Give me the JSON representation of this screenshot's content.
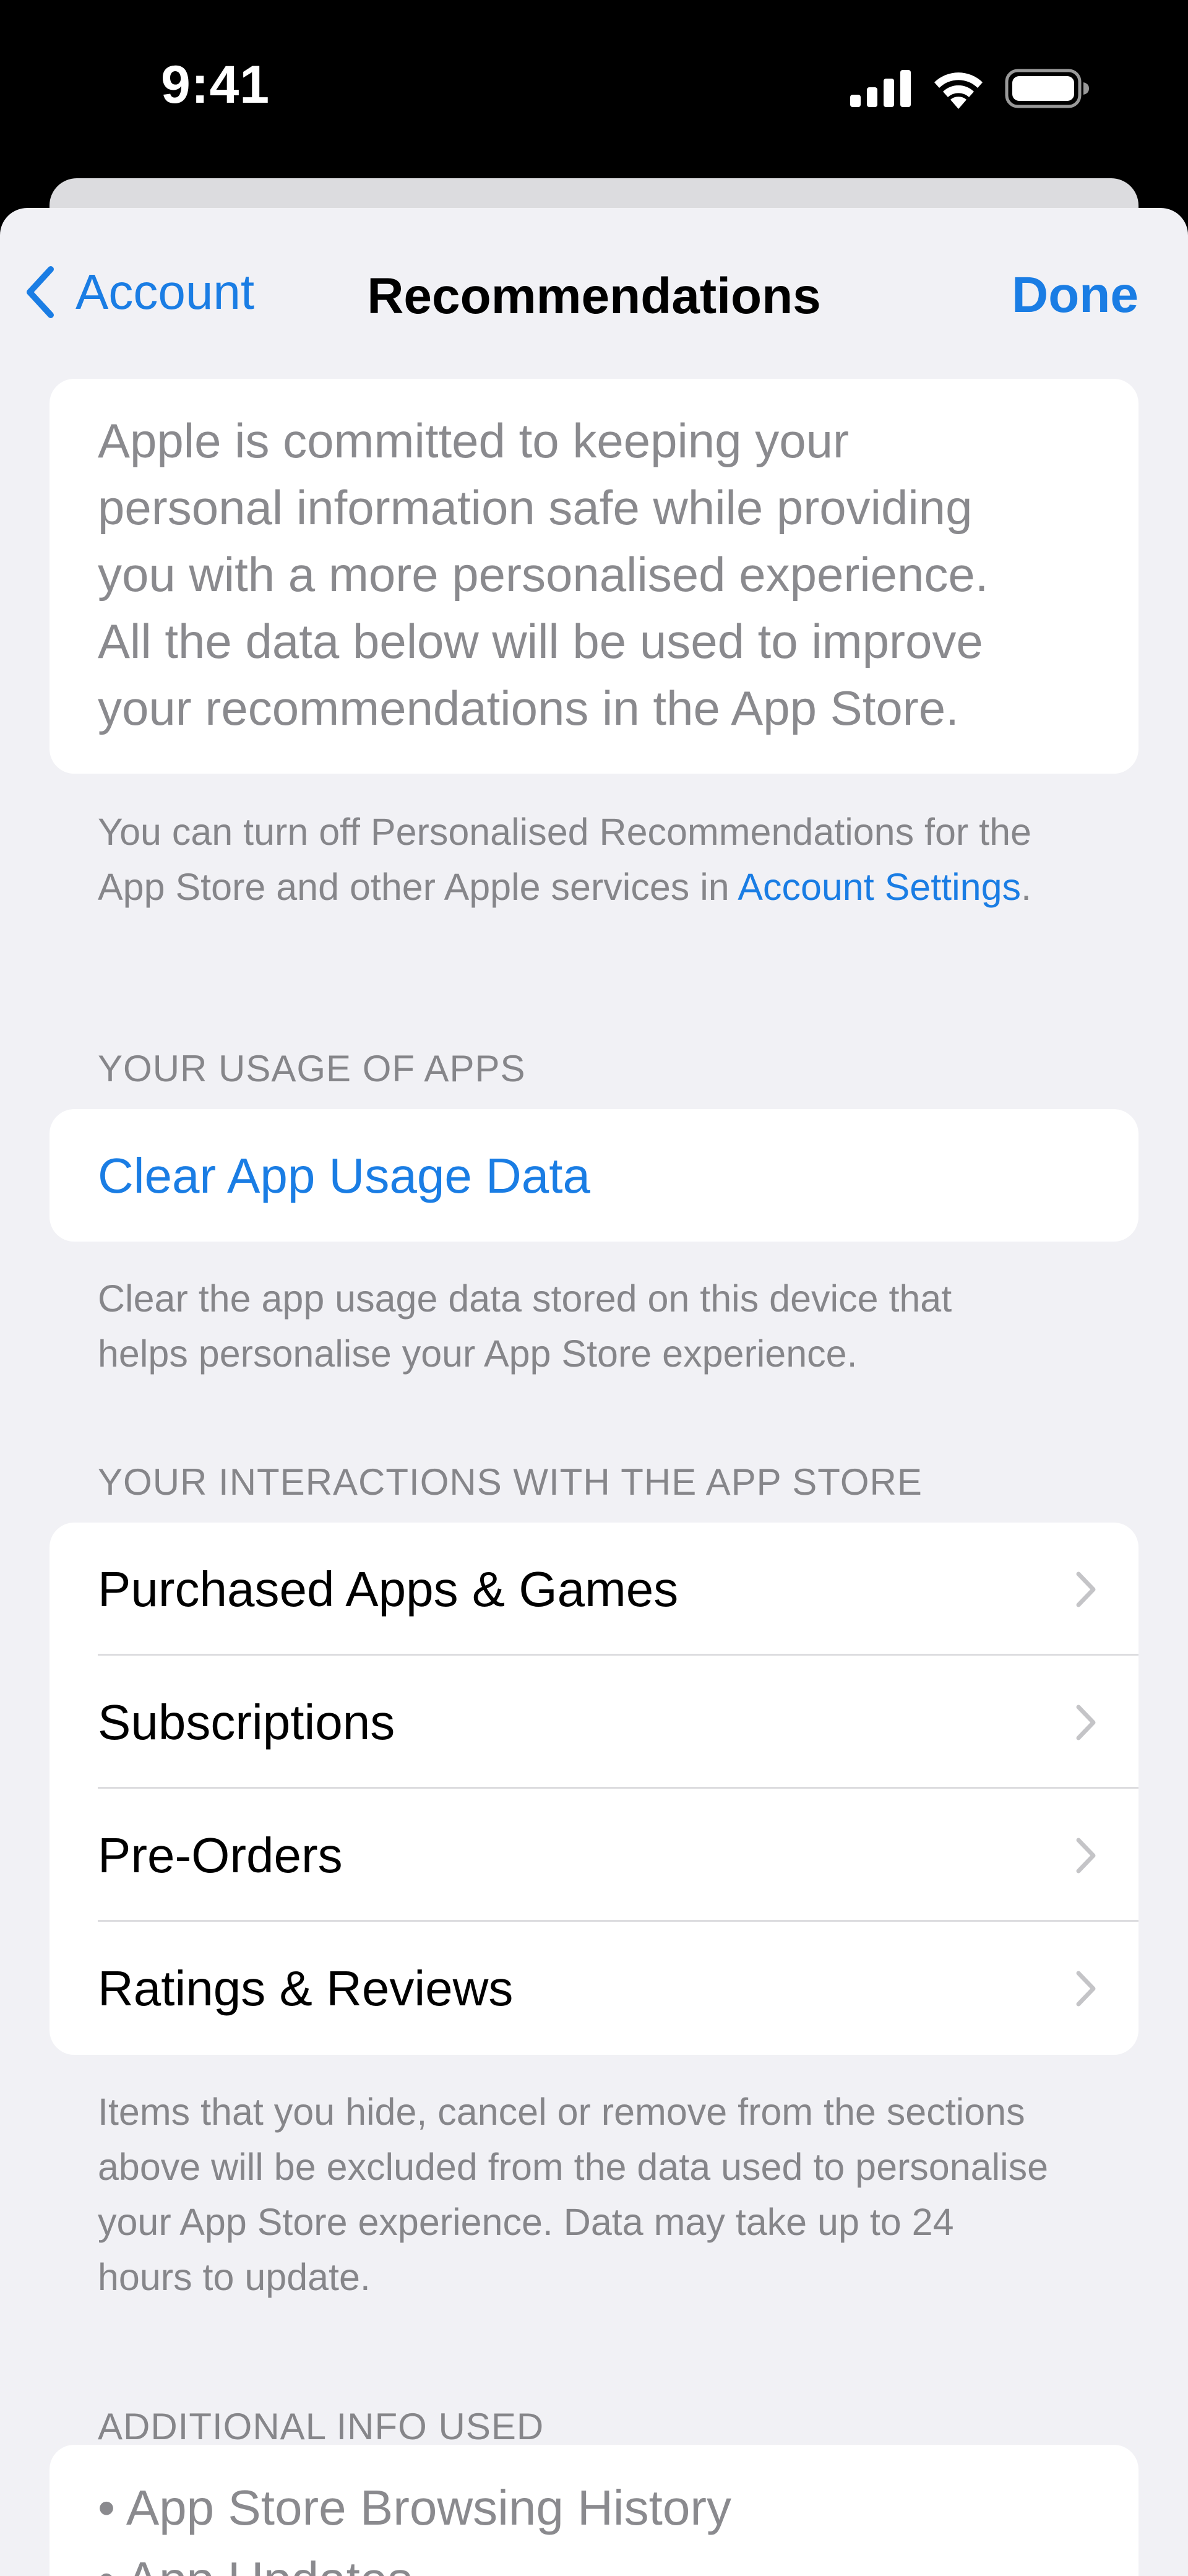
{
  "status_bar": {
    "time": "9:41",
    "icons": [
      "cellular-signal-icon",
      "wifi-icon",
      "battery-icon"
    ]
  },
  "nav": {
    "back_label": "Account",
    "title": "Recommendations",
    "done_label": "Done"
  },
  "intro": {
    "lines": [
      "Apple is committed to keeping your",
      "personal information safe while providing",
      "you with a more personalised experience.",
      "All the data below will be used to improve",
      "your recommendations in the App Store."
    ]
  },
  "turn_off_note": {
    "line1": "You can turn off Personalised Recommendations for the",
    "line2_prefix": "App Store and other Apple services in ",
    "link": "Account Settings",
    "line2_suffix": "."
  },
  "usage_section": {
    "header": "YOUR USAGE OF APPS",
    "button": "Clear App Usage Data",
    "footer_lines": [
      "Clear the app usage data stored on this device that",
      "helps personalise your App Store experience."
    ]
  },
  "interactions_section": {
    "header": "YOUR INTERACTIONS WITH THE APP STORE",
    "items": [
      {
        "label": "Purchased Apps & Games"
      },
      {
        "label": "Subscriptions"
      },
      {
        "label": "Pre-Orders"
      },
      {
        "label": "Ratings & Reviews"
      }
    ],
    "footer_lines": [
      "Items that you hide, cancel or remove from the sections",
      "above will be excluded from the data used to personalise",
      "your App Store experience. Data may take up to 24",
      "hours to update."
    ]
  },
  "additional_section": {
    "header": "ADDITIONAL INFO USED",
    "items": [
      "• App Store Browsing History",
      "• App Updates"
    ]
  },
  "colors": {
    "accent": "#1a7de4",
    "background": "#f1f1f5",
    "secondary_text": "#86868a"
  }
}
